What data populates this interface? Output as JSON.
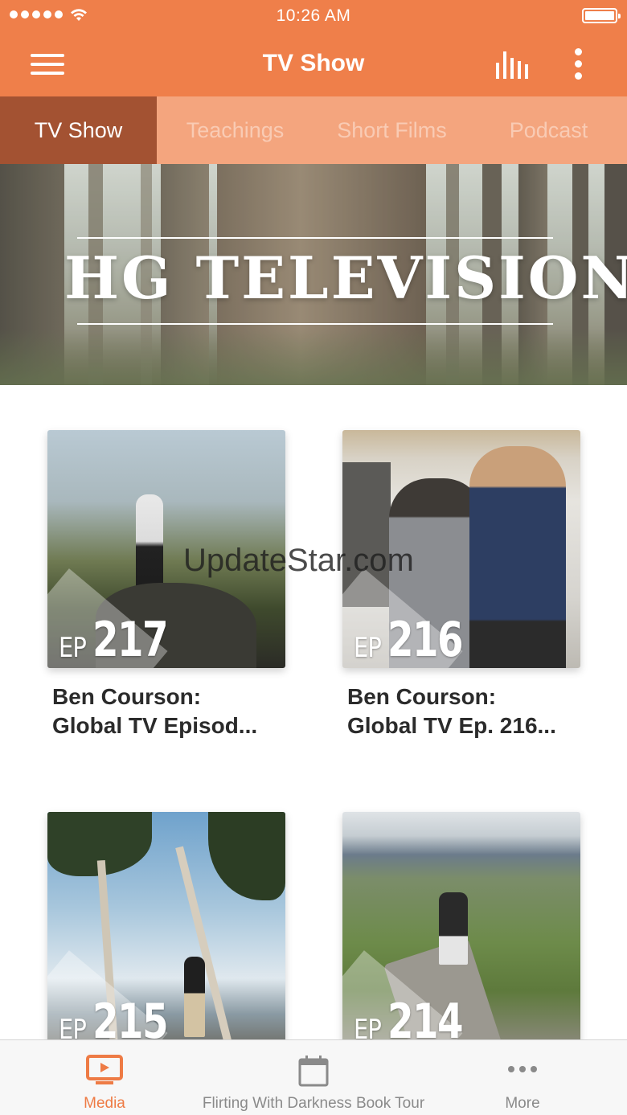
{
  "status_bar": {
    "time": "10:26 AM"
  },
  "header": {
    "title": "TV Show"
  },
  "tabs": [
    {
      "label": "TV Show",
      "active": true
    },
    {
      "label": "Teachings",
      "active": false
    },
    {
      "label": "Short Films",
      "active": false
    },
    {
      "label": "Podcast",
      "active": false
    }
  ],
  "banner": {
    "title": "HG TELEVISION"
  },
  "episodes": [
    {
      "prefix": "EP",
      "number": "217",
      "title_line1": "Ben Courson:",
      "title_line2": "Global TV Episod..."
    },
    {
      "prefix": "EP",
      "number": "216",
      "title_line1": "Ben Courson:",
      "title_line2": "Global TV Ep. 216..."
    },
    {
      "prefix": "EP",
      "number": "215"
    },
    {
      "prefix": "EP",
      "number": "214"
    }
  ],
  "watermark": "UpdateStar.com",
  "bottom_tabs": [
    {
      "label": "Media",
      "icon": "tv-icon",
      "active": true
    },
    {
      "label": "Flirting With Darkness Book Tour",
      "icon": "calendar-icon",
      "active": false
    },
    {
      "label": "More",
      "icon": "more-dots-icon",
      "active": false
    }
  ],
  "colors": {
    "accent": "#ef7f4a",
    "tab_bar": "#f4a57e",
    "tab_active": "#a35232",
    "active_icon": "#ee7b45"
  }
}
